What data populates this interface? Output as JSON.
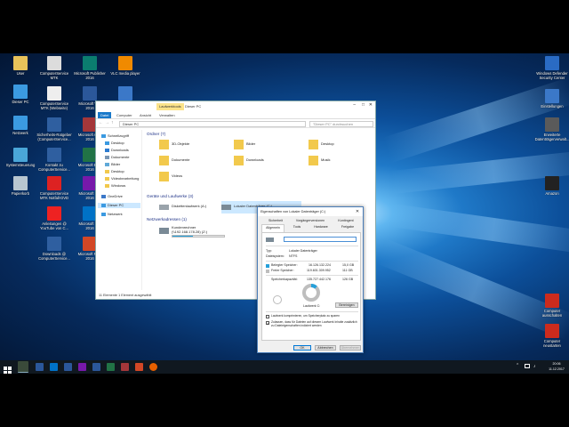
{
  "desktop_icons": [
    {
      "label": "User",
      "color": "#e8c25a"
    },
    {
      "label": "Dieser PC",
      "color": "#3b9ae1"
    },
    {
      "label": "Netzwerk",
      "color": "#3b9ae1"
    },
    {
      "label": "Systemsteuerung",
      "color": "#4aa6d8"
    },
    {
      "label": "Papierkorb",
      "color": "#b8c6d0"
    },
    {
      "label": "ComputerService\nMTK",
      "color": "#dcdcdc"
    },
    {
      "label": "ComputerService\nMTK (Webseite)",
      "color": "#eeeeee"
    },
    {
      "label": "Sicherheits-Ratgeber\n(ComputerService...",
      "color": "#2f5fa0"
    },
    {
      "label": "Kontakt zu\nComputerService...",
      "color": "#2f5fa0"
    },
    {
      "label": "ComputerService\nMTK Notfall-DVD",
      "color": "#d22"
    },
    {
      "label": "Anleitungen @\nYouTube von C...",
      "color": "#e22"
    },
    {
      "label": "Downloads @\nComputerService...",
      "color": "#2f5fa0"
    },
    {
      "label": "Microsoft Publisher\n2016",
      "color": "#0b7d6f"
    },
    {
      "label": "Microsoft W...\n2016",
      "color": "#2b579a"
    },
    {
      "label": "Microsoft Ac...\n2016",
      "color": "#a4373a"
    },
    {
      "label": "Microsoft Ex...\n2016",
      "color": "#217346"
    },
    {
      "label": "Microsoft O...\n2016",
      "color": "#7719aa"
    },
    {
      "label": "Microsoft O...\n2016",
      "color": "#0072c6"
    },
    {
      "label": "Microsoft Pe...\n2016",
      "color": "#d24726"
    },
    {
      "label": "VLC media player",
      "color": "#f08a00"
    },
    {
      "label": "",
      "color": "#3b78c8"
    },
    {
      "label": "Windows Defender\nSecurity Center",
      "color": "#2a6bc4"
    },
    {
      "label": "Einstellungen",
      "color": "#3b78c8"
    },
    {
      "label": "Erweiterte\nDatenträgerverwalt...",
      "color": "#5a5a5a"
    },
    {
      "label": "Amazon",
      "color": "#222"
    },
    {
      "label": "Computer\nausschalten",
      "color": "#cc2b1d"
    },
    {
      "label": "Computer\nneustarten",
      "color": "#cc2b1d"
    }
  ],
  "explorer": {
    "title": "Dieser PC",
    "context_tab": "Laufwerktools",
    "ribbon_tabs": [
      "Datei",
      "Computer",
      "Ansicht",
      "Verwalten"
    ],
    "address": "Dieser PC",
    "search_placeholder": "\"Dieser PC\" durchsuchen",
    "nav": [
      "Schnellzugriff",
      "Desktop",
      "Downloads",
      "Dokumente",
      "Bilder",
      "Desktop",
      "Videobearbeitung",
      "Windows",
      "OneDrive",
      "Dieser PC",
      "Netzwerk"
    ],
    "group_folders": "Ordner (7)",
    "folders": [
      "3D-Objekte",
      "Bilder",
      "Desktop",
      "Dokumente",
      "Downloads",
      "Musik",
      "Videos"
    ],
    "group_drives": "Geräte und Laufwerke (3)",
    "drives": [
      "Diskettenlaufwerk (A:)",
      "Lokaler Datenträger (C:)"
    ],
    "group_net": "Netzwerkadressen (1)",
    "net_item": "Kundenrechner",
    "net_sub": "(\\\\192.168.178.28) (Z:)",
    "status": "11 Elemente    1 Element ausgewählt"
  },
  "dialog": {
    "title": "Eigenschaften von Lokaler Datenträger (C:)",
    "tabs_row1": [
      "Sicherheit",
      "Vorgängerversionen",
      "Kontingent"
    ],
    "tabs_row2": [
      "Allgemein",
      "Tools",
      "Hardware",
      "Freigabe"
    ],
    "type_label": "Typ:",
    "type_value": "Lokaler Datenträger",
    "fs_label": "Dateisystem:",
    "fs_value": "NTFS",
    "used_label": "Belegter Speicher:",
    "used_bytes": "16.126.132.224",
    "used_gb": "15,0 GB",
    "free_label": "Freier Speicher:",
    "free_bytes": "119.601.309.952",
    "free_gb": "111 GB",
    "cap_label": "Speicherkapazität:",
    "cap_bytes": "135.727.442.176",
    "cap_gb": "126 GB",
    "drive_label": "Laufwerk C:",
    "cleanup_button": "Bereinigen",
    "compress_label": "Laufwerk komprimieren, um Speicherplatz zu sparen",
    "index_label": "Zulassen, dass für Dateien auf diesem Laufwerk Inhalte zusätzlich zu Dateieigenschaften indiziert werden",
    "ok": "OK",
    "cancel": "Abbrechen",
    "apply": "Übernehmen",
    "used_fraction": 0.119,
    "used_color": "#26a0da",
    "free_color": "#bebebe"
  },
  "taskbar": {
    "time": "20:06",
    "date": "11.12.2017"
  }
}
